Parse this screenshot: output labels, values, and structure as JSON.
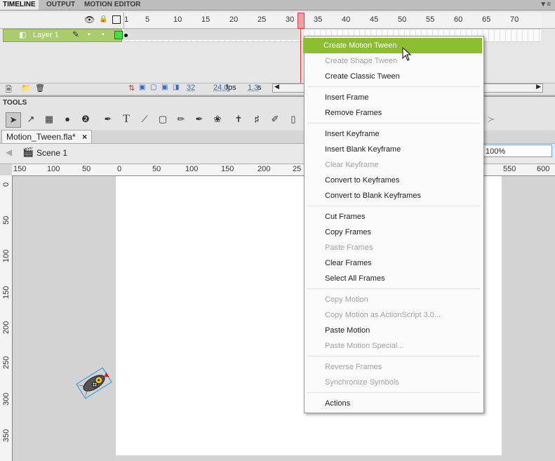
{
  "timeline": {
    "tabs": [
      "TIMELINE",
      "OUTPUT",
      "MOTION EDITOR"
    ],
    "frame_numbers": [
      "1",
      "5",
      "10",
      "15",
      "20",
      "25",
      "30",
      "35",
      "40",
      "45",
      "50",
      "55",
      "60",
      "65",
      "70"
    ],
    "layer_name": "Layer 1",
    "current_frame": "32",
    "fps": "24.0",
    "fps_unit": "fps",
    "time": "1.3",
    "time_unit": "s"
  },
  "tools": {
    "title": "TOOLS",
    "items": [
      "selection-tool",
      "subselection-tool",
      "free-transform-tool",
      "3d-rotation-tool",
      "lasso-tool",
      "pen-tool",
      "text-tool",
      "line-tool",
      "rectangle-tool",
      "pencil-tool",
      "brush-tool",
      "deco-tool",
      "bone-tool",
      "paint-bucket-tool",
      "eyedropper-tool",
      "eraser-tool"
    ]
  },
  "document": {
    "tab_title": "Motion_Tween.fla*",
    "tab_close": "×",
    "scene": "Scene 1",
    "zoom": "100%"
  },
  "rulers": {
    "h_labels": [
      "150",
      "100",
      "50",
      "0",
      "50",
      "100",
      "150",
      "200",
      "25",
      "550",
      "600"
    ],
    "v_labels": [
      "0",
      "50",
      "100",
      "150",
      "200",
      "250",
      "300",
      "350"
    ]
  },
  "context_menu": {
    "items": [
      {
        "label": "Create Motion Tween",
        "state": "highlighted"
      },
      {
        "label": "Create Shape Tween",
        "state": "disabled"
      },
      {
        "label": "Create Classic Tween",
        "state": "enabled"
      },
      {
        "label": "Insert Frame",
        "state": "enabled"
      },
      {
        "label": "Remove Frames",
        "state": "enabled"
      },
      {
        "label": "Insert Keyframe",
        "state": "enabled"
      },
      {
        "label": "Insert Blank Keyframe",
        "state": "enabled"
      },
      {
        "label": "Clear Keyframe",
        "state": "disabled"
      },
      {
        "label": "Convert to Keyframes",
        "state": "enabled"
      },
      {
        "label": "Convert to Blank Keyframes",
        "state": "enabled"
      },
      {
        "label": "Cut Frames",
        "state": "enabled"
      },
      {
        "label": "Copy Frames",
        "state": "enabled"
      },
      {
        "label": "Paste Frames",
        "state": "disabled"
      },
      {
        "label": "Clear Frames",
        "state": "enabled"
      },
      {
        "label": "Select All Frames",
        "state": "enabled"
      },
      {
        "label": "Copy Motion",
        "state": "disabled"
      },
      {
        "label": "Copy Motion as ActionScript 3.0...",
        "state": "disabled"
      },
      {
        "label": "Paste Motion",
        "state": "enabled"
      },
      {
        "label": "Paste Motion Special...",
        "state": "disabled"
      },
      {
        "label": "Reverse Frames",
        "state": "disabled"
      },
      {
        "label": "Synchronize Symbols",
        "state": "disabled"
      },
      {
        "label": "Actions",
        "state": "enabled"
      }
    ]
  },
  "colors": {
    "layer_selected": "#a9cd6b",
    "menu_highlight": "#8cbf30",
    "playhead": "#d33333",
    "stage": "#ffffff",
    "pasteboard": "#d3d3d3"
  }
}
